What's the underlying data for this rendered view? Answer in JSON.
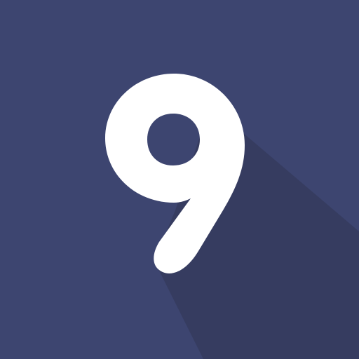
{
  "tile": {
    "digit": "9",
    "background_color": "#3d4570",
    "digit_color": "#ffffff",
    "shadow_color": "#363c60"
  }
}
